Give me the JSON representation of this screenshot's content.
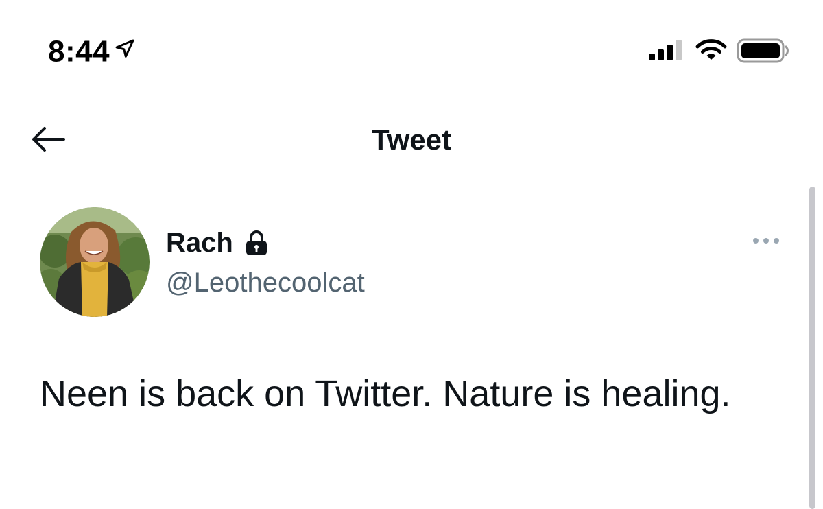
{
  "status_bar": {
    "time": "8:44",
    "icons": [
      "location-arrow-icon",
      "cellular-signal-icon",
      "wifi-icon",
      "battery-icon"
    ]
  },
  "nav": {
    "title": "Tweet",
    "back_icon": "arrow-left-icon"
  },
  "tweet": {
    "display_name": "Rach",
    "protected_icon": "lock-icon",
    "handle": "@Leothecoolcat",
    "more_icon": "more-dots-icon",
    "text": "Neen is back on Twitter. Nature is healing."
  },
  "colors": {
    "text_primary": "#0f1419",
    "text_secondary": "#536471",
    "background": "#ffffff"
  }
}
